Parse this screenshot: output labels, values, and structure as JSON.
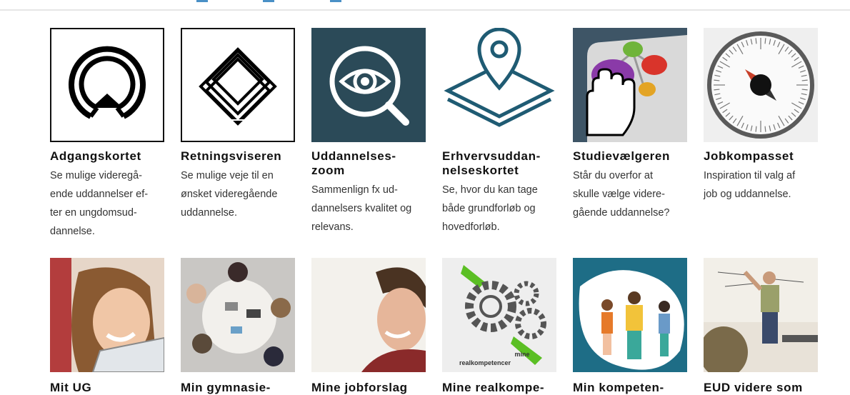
{
  "row1": [
    {
      "title": "Adgangskortet",
      "description": "Se mulige videregå-\nende uddannelser ef-\nter en ungdomsud-\ndannelse.",
      "icon": "access-card-icon"
    },
    {
      "title": "Retningsviseren",
      "description": "Se mulige veje til en\nønsket videregående\nuddannelse.",
      "icon": "direction-layers-icon"
    },
    {
      "title": "Uddannelses-\nzoom",
      "description": "Sammenlign fx ud-\ndannelsers kvalitet og\nrelevans.",
      "icon": "eye-magnifier-icon"
    },
    {
      "title": "Erhvervsuddan-\nnelseskortet",
      "description": "Se, hvor du kan tage\nbåde grundforløb og\nhovedforløb.",
      "icon": "map-pin-layers-icon"
    },
    {
      "title": "Studievælgeren",
      "description": "Står du overfor at\nskulle vælge videre-\ngående uddannelse?",
      "icon": "hand-cursor-buttons-icon"
    },
    {
      "title": "Jobkompasset",
      "description": "Inspiration til valg af\njob og uddannelse.",
      "icon": "compass-icon"
    }
  ],
  "row2": [
    {
      "title": "Mit UG",
      "image": "smiling-girl-photo"
    },
    {
      "title": "Min gymnasie-",
      "image": "group-table-photo"
    },
    {
      "title": "Mine jobforslag",
      "image": "smiling-boy-photo"
    },
    {
      "title": "Mine realkompe-",
      "image": "gears-wrench-illustration",
      "image_text": "mine\nrealkompetencer"
    },
    {
      "title": "Min kompeten-",
      "image": "people-illustration"
    },
    {
      "title": "EUD videre som",
      "image": "teacher-whiteboard-photo"
    }
  ],
  "colors": {
    "dark_teal": "#2b4a58",
    "teal": "#1f5b73",
    "text": "#222222"
  }
}
